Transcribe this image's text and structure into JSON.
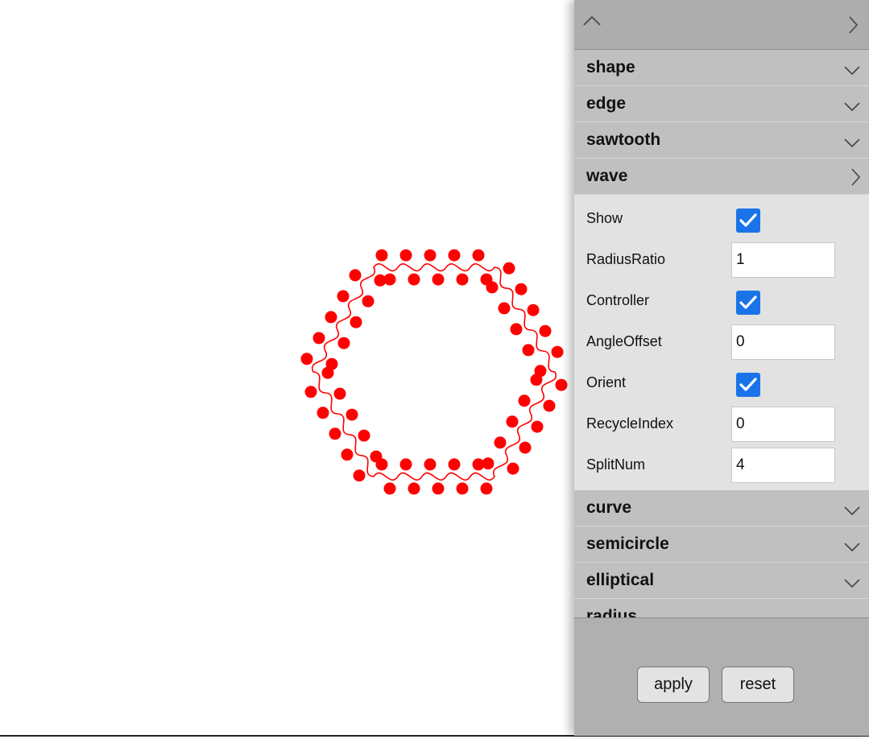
{
  "panel": {
    "sections_before": [
      {
        "id": "shape",
        "title": "shape"
      },
      {
        "id": "edge",
        "title": "edge"
      },
      {
        "id": "sawtooth",
        "title": "sawtooth"
      }
    ],
    "wave": {
      "title": "wave",
      "expanded": true,
      "fields": [
        {
          "label": "Show",
          "type": "checkbox",
          "checked": true
        },
        {
          "label": "RadiusRatio",
          "type": "number",
          "value": "1"
        },
        {
          "label": "Controller",
          "type": "checkbox",
          "checked": true
        },
        {
          "label": "AngleOffset",
          "type": "number",
          "value": "0"
        },
        {
          "label": "Orient",
          "type": "checkbox",
          "checked": true
        },
        {
          "label": "RecycleIndex",
          "type": "number",
          "value": "0"
        },
        {
          "label": "SplitNum",
          "type": "number",
          "value": "4"
        }
      ]
    },
    "sections_after": [
      {
        "id": "curve",
        "title": "curve"
      },
      {
        "id": "semicircle",
        "title": "semicircle"
      },
      {
        "id": "elliptical",
        "title": "elliptical"
      }
    ],
    "cut_section_title": "radius",
    "apply_label": "apply",
    "reset_label": "reset"
  },
  "canvas": {
    "shape": "hexagon",
    "polygon_sides": 6,
    "edge_split_num": 4,
    "wave_ratio": 1,
    "show_controllers": true,
    "color": "#ff0000"
  },
  "colors": {
    "panel_bg": "#b0b0b0",
    "section_header": "#c0c0c0",
    "section_body": "#e2e2e2",
    "checkbox": "#1a73e8",
    "drawing": "#ff0000"
  }
}
